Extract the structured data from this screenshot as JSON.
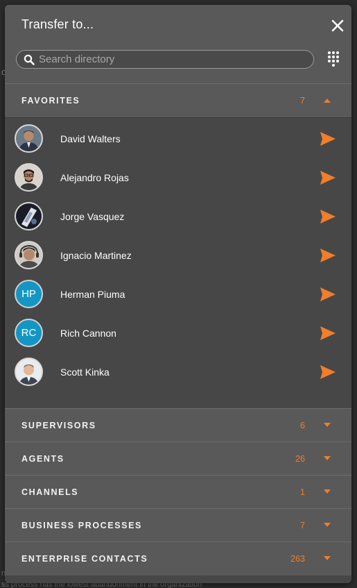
{
  "modal": {
    "title": "Transfer to...",
    "close_icon": "close-icon",
    "search": {
      "placeholder": "Search directory",
      "value": ""
    },
    "dialpad_icon": "dialpad-icon"
  },
  "colors": {
    "accent": "#f07e2a",
    "initials_bg": "#1496c4",
    "header_bg": "#595959",
    "body_bg": "#474747"
  },
  "favorites": {
    "label": "FAVORITES",
    "count": "7",
    "expanded": true,
    "contacts": [
      {
        "name": "David Walters",
        "avatar": "photo"
      },
      {
        "name": "Alejandro Rojas",
        "avatar": "photo"
      },
      {
        "name": "Jorge Vasquez",
        "avatar": "photo"
      },
      {
        "name": "Ignacio Martinez",
        "avatar": "photo"
      },
      {
        "name": "Herman Piuma",
        "avatar": "initials",
        "initials": "HP"
      },
      {
        "name": "Rich Cannon",
        "avatar": "initials",
        "initials": "RC"
      },
      {
        "name": "Scott Kinka",
        "avatar": "photo"
      }
    ]
  },
  "sections": [
    {
      "label": "SUPERVISORS",
      "count": "6"
    },
    {
      "label": "AGENTS",
      "count": "26"
    },
    {
      "label": "CHANNELS",
      "count": "1"
    },
    {
      "label": "BUSINESS PROCESSES",
      "count": "7"
    },
    {
      "label": "ENTERPRISE CONTACTS",
      "count": "263"
    }
  ],
  "background": {
    "footer_text": "ss process has the lowest abandonment in the organization"
  }
}
